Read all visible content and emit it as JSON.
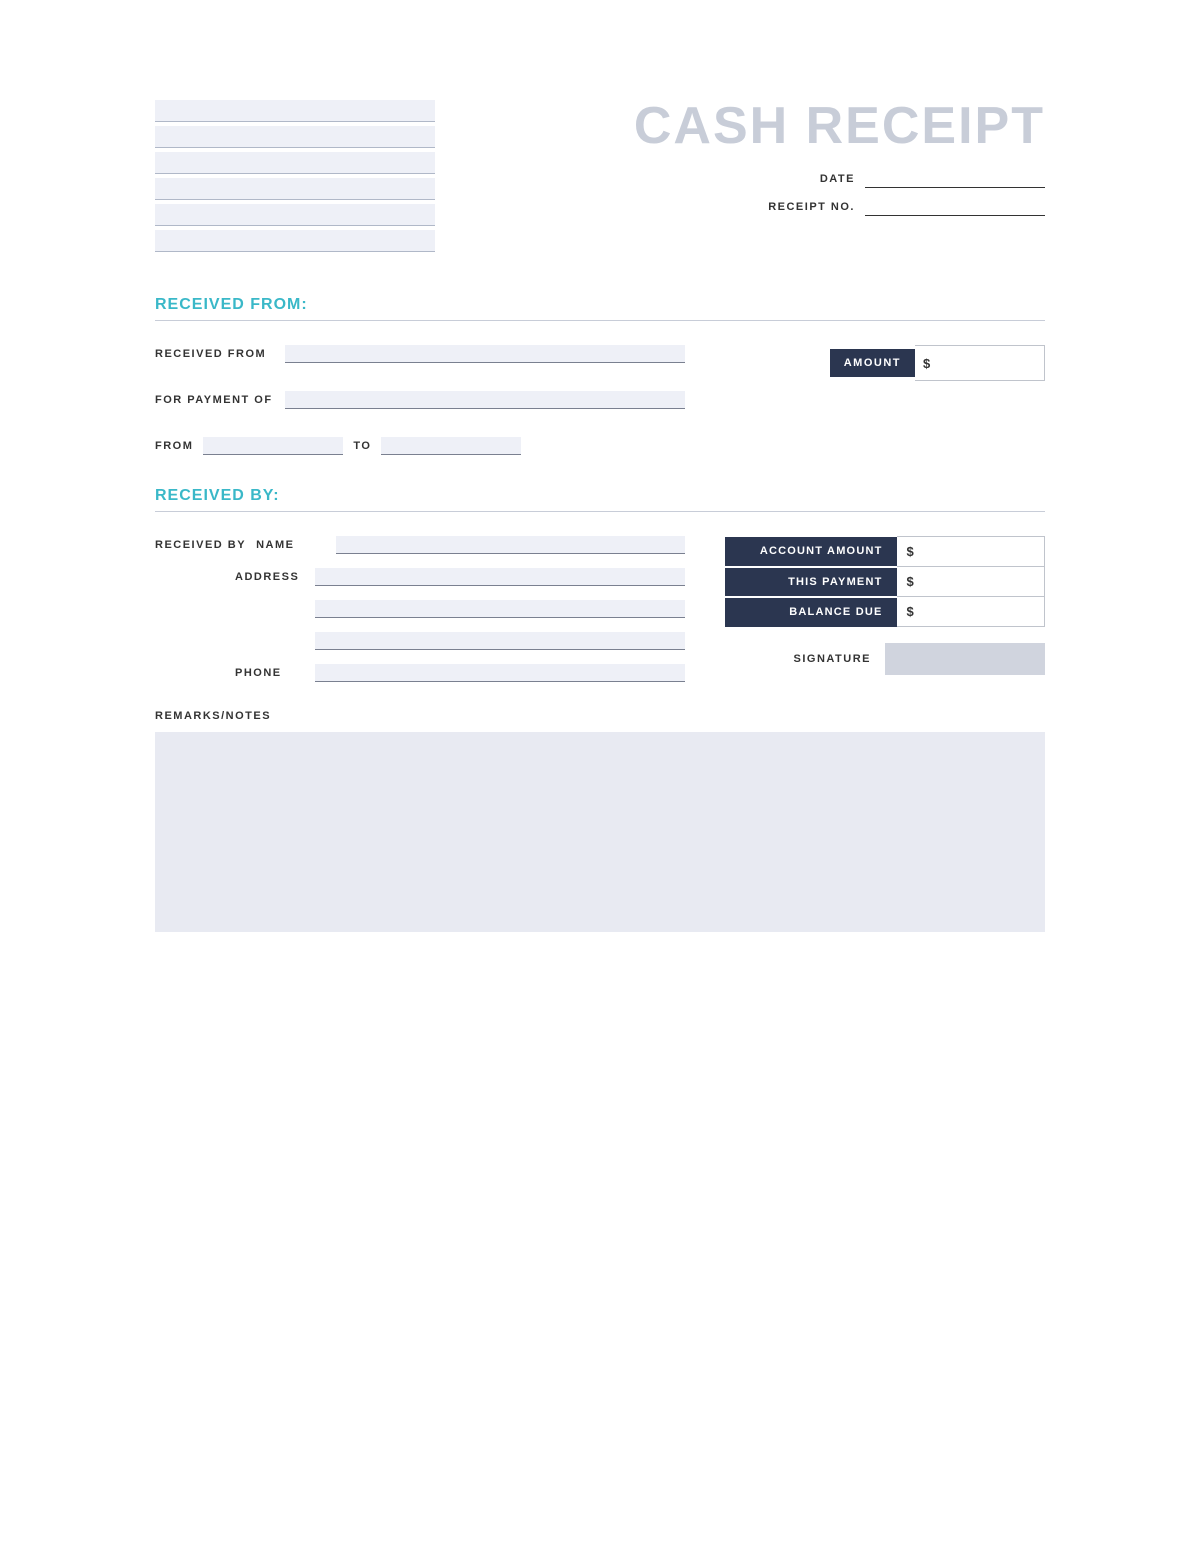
{
  "title": "CASH RECEIPT",
  "header": {
    "date_label": "DATE",
    "receipt_no_label": "RECEIPT NO."
  },
  "received_from_section": {
    "heading": "RECEIVED FROM:",
    "received_from_label": "RECEIVED FROM",
    "for_payment_of_label": "FOR PAYMENT OF",
    "from_label": "FROM",
    "to_label": "TO",
    "amount_label": "AMOUNT",
    "dollar_sign": "$"
  },
  "received_by_section": {
    "heading": "RECEIVED BY:",
    "received_by_label": "RECEIVED BY",
    "name_label": "NAME",
    "address_label": "ADDRESS",
    "phone_label": "PHONE",
    "account_amount_label": "ACCOUNT AMOUNT",
    "this_payment_label": "THIS PAYMENT",
    "balance_due_label": "BALANCE DUE",
    "dollar_sign": "$",
    "signature_label": "SIGNATURE"
  },
  "remarks_section": {
    "heading": "REMARKS/NOTES"
  }
}
